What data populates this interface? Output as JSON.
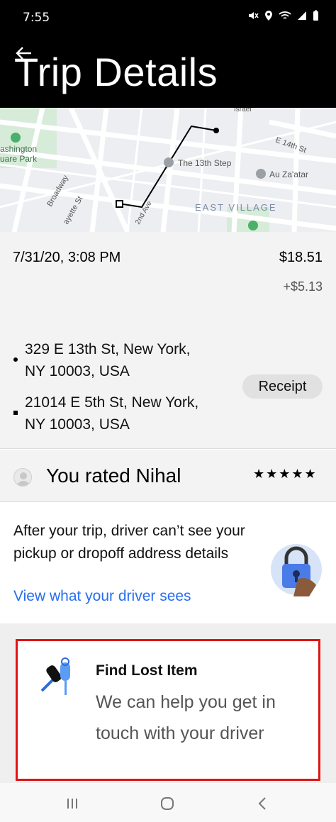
{
  "status_bar": {
    "time": "7:55",
    "icons": [
      "mute-icon",
      "location-icon",
      "wifi-icon",
      "signal-icon",
      "battery-icon"
    ]
  },
  "header": {
    "title": "Trip Details",
    "back_icon": "back-arrow-icon"
  },
  "map": {
    "labels": {
      "park": "ashington\nuare Park",
      "restaurant": "The 13th Step",
      "street_broadway": "Broadway",
      "street_lafayette": "ayette St",
      "street_2nd_ave": "2nd Ave",
      "street_e14": "E 14th St",
      "restaurant2": "Au Za'atar",
      "neighborhood": "EAST VILLAGE",
      "top_label": "Israel"
    }
  },
  "trip": {
    "datetime": "7/31/20, 3:08 PM",
    "price": "$18.51",
    "extra_charge": "+$5.13",
    "pickup": {
      "line1": "329 E 13th St, New York,",
      "line2": "NY 10003, USA"
    },
    "dropoff": {
      "line1": "21014 E 5th St, New York,",
      "line2": "NY 10003, USA"
    },
    "receipt_label": "Receipt"
  },
  "rating": {
    "text": "You rated Nihal",
    "stars": "★★★★★",
    "star_count": 5
  },
  "privacy": {
    "text": "After your trip, driver can’t see your pickup or dropoff address details",
    "link": "View what your driver sees",
    "link_color": "#276ef1"
  },
  "lost_item": {
    "title": "Find Lost Item",
    "description": "We can help you get in touch with your driver",
    "highlight_color": "#e01414"
  },
  "nav": {
    "recents": "recents-icon",
    "home": "home-icon",
    "back": "back-icon"
  }
}
